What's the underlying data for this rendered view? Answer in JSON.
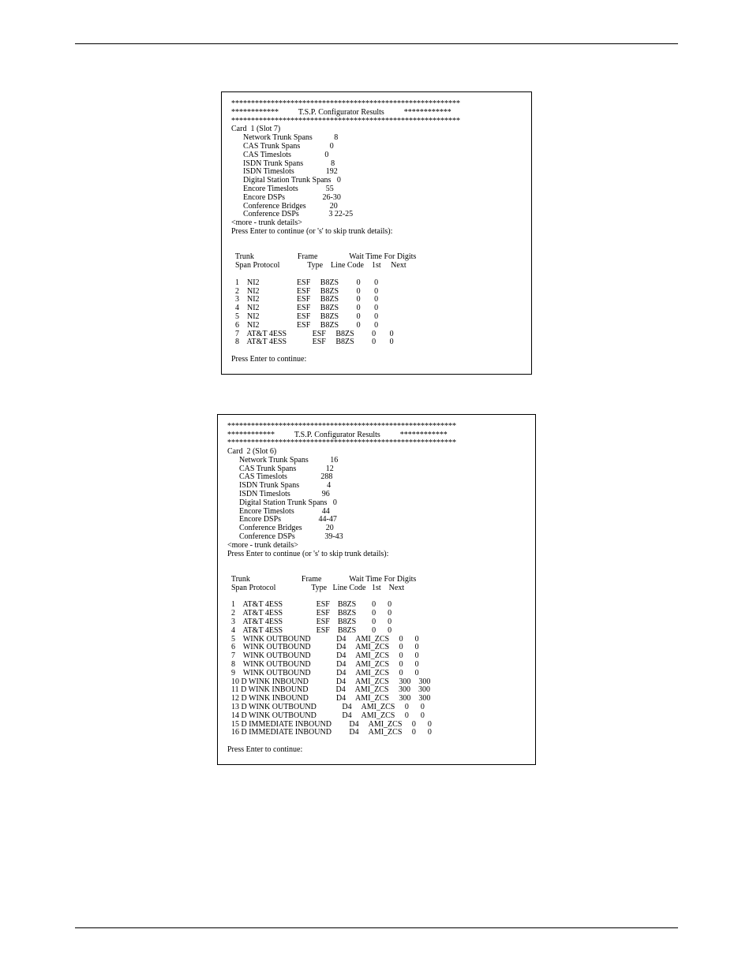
{
  "header_title": "T.S.P. Configurator Results",
  "star_long": "**********************************************************",
  "star_short": "************",
  "box1": {
    "card": "Card  1 (Slot 7)",
    "stats": [
      [
        "Network Trunk Spans",
        "8"
      ],
      [
        "CAS Trunk Spans",
        "0"
      ],
      [
        "CAS Timeslots",
        "0"
      ],
      [
        "ISDN Trunk Spans",
        "8"
      ],
      [
        "ISDN Timeslots",
        "192"
      ],
      [
        "Digital Station Trunk Spans",
        "0"
      ],
      [
        "Encore Timeslots",
        "55"
      ],
      [
        "Encore DSPs",
        "26-30"
      ],
      [
        "Conference Bridges",
        "20"
      ],
      [
        "Conference DSPs",
        "3 22-25"
      ]
    ],
    "more": "<more - trunk details>",
    "prompt_skip": "Press Enter to continue (or 's' to skip trunk details):",
    "table_hdr1": [
      "Trunk",
      "Frame",
      "",
      "Wait Time For Digits"
    ],
    "table_hdr2": [
      "Span",
      "Protocol",
      "Type",
      "Line Code",
      "1st",
      "Next"
    ],
    "rows": [
      [
        "1",
        "",
        "NI2",
        "ESF",
        "B8ZS",
        "0",
        "0"
      ],
      [
        "2",
        "",
        "NI2",
        "ESF",
        "B8ZS",
        "0",
        "0"
      ],
      [
        "3",
        "",
        "NI2",
        "ESF",
        "B8ZS",
        "0",
        "0"
      ],
      [
        "4",
        "",
        "NI2",
        "ESF",
        "B8ZS",
        "0",
        "0"
      ],
      [
        "5",
        "",
        "NI2",
        "ESF",
        "B8ZS",
        "0",
        "0"
      ],
      [
        "6",
        "",
        "NI2",
        "ESF",
        "B8ZS",
        "0",
        "0"
      ],
      [
        "7",
        "",
        "AT&T 4ESS",
        "ESF",
        "B8ZS",
        "0",
        "0"
      ],
      [
        "8",
        "",
        "AT&T 4ESS",
        "ESF",
        "B8ZS",
        "0",
        "0"
      ]
    ],
    "prompt_end": "Press Enter to continue:"
  },
  "box2": {
    "card": "Card  2 (Slot 6)",
    "stats": [
      [
        "Network Trunk Spans",
        "16"
      ],
      [
        "CAS Trunk Spans",
        "12"
      ],
      [
        "CAS Timeslots",
        "288"
      ],
      [
        "ISDN Trunk Spans",
        "4"
      ],
      [
        "ISDN Timeslots",
        "96"
      ],
      [
        "Digital Station Trunk Spans",
        "0"
      ],
      [
        "Encore Timeslots",
        "44"
      ],
      [
        "Encore DSPs",
        "44-47"
      ],
      [
        "Conference Bridges",
        "20"
      ],
      [
        "Conference DSPs",
        "39-43"
      ]
    ],
    "more": "<more - trunk details>",
    "prompt_skip": "Press Enter to continue (or 's' to skip trunk details):",
    "table_hdr1": [
      "Trunk",
      "Frame",
      "",
      "Wait Time For Digits"
    ],
    "table_hdr2": [
      "Span",
      "Protocol",
      "Type",
      "Line Code",
      "1st",
      "Next"
    ],
    "rows": [
      [
        "1",
        "",
        "AT&T 4ESS",
        "ESF",
        "B8ZS",
        "0",
        "0"
      ],
      [
        "2",
        "",
        "AT&T 4ESS",
        "ESF",
        "B8ZS",
        "0",
        "0"
      ],
      [
        "3",
        "",
        "AT&T 4ESS",
        "ESF",
        "B8ZS",
        "0",
        "0"
      ],
      [
        "4",
        "",
        "AT&T 4ESS",
        "ESF",
        "B8ZS",
        "0",
        "0"
      ],
      [
        "5",
        "",
        "WINK OUTBOUND",
        "D4",
        "AMI_ZCS",
        "0",
        "0"
      ],
      [
        "6",
        "",
        "WINK OUTBOUND",
        "D4",
        "AMI_ZCS",
        "0",
        "0"
      ],
      [
        "7",
        "",
        "WINK OUTBOUND",
        "D4",
        "AMI_ZCS",
        "0",
        "0"
      ],
      [
        "8",
        "",
        "WINK OUTBOUND",
        "D4",
        "AMI_ZCS",
        "0",
        "0"
      ],
      [
        "9",
        "",
        "WINK OUTBOUND",
        "D4",
        "AMI_ZCS",
        "0",
        "0"
      ],
      [
        "10",
        "D",
        "WINK INBOUND",
        "D4",
        "AMI_ZCS",
        "300",
        "300"
      ],
      [
        "11",
        "D",
        "WINK INBOUND",
        "D4",
        "AMI_ZCS",
        "300",
        "300"
      ],
      [
        "12",
        "D",
        "WINK INBOUND",
        "D4",
        "AMI_ZCS",
        "300",
        "300"
      ],
      [
        "13",
        "D",
        "WINK OUTBOUND",
        "D4",
        "AMI_ZCS",
        "0",
        "0"
      ],
      [
        "14",
        "D",
        "WINK OUTBOUND",
        "D4",
        "AMI_ZCS",
        "0",
        "0"
      ],
      [
        "15",
        "D",
        "IMMEDIATE INBOUND",
        "D4",
        "AMI_ZCS",
        "0",
        "0"
      ],
      [
        "16",
        "D",
        "IMMEDIATE INBOUND",
        "D4",
        "AMI_ZCS",
        "0",
        "0"
      ]
    ],
    "prompt_end": "Press Enter to continue:"
  }
}
